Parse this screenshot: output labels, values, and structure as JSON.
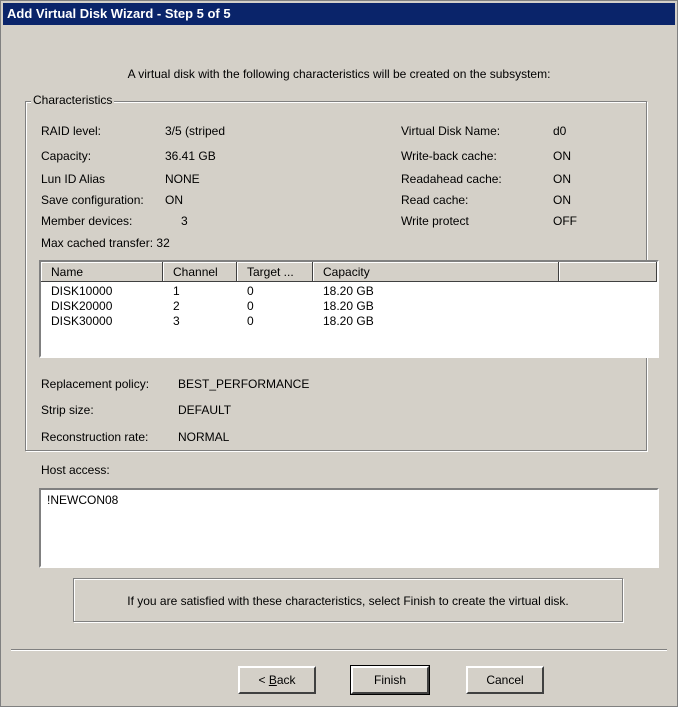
{
  "window": {
    "title": "Add Virtual Disk Wizard - Step 5 of 5"
  },
  "intro": "A virtual disk with the following characteristics will be created on the subsystem:",
  "characteristics": {
    "legend": "Characteristics",
    "left": [
      {
        "label": "RAID level:",
        "value": "3/5 (striped"
      },
      {
        "label": "Capacity:",
        "value": "36.41 GB"
      },
      {
        "label": "Lun ID Alias",
        "value": "NONE"
      },
      {
        "label": "Save configuration:",
        "value": "ON"
      },
      {
        "label": "Member devices:",
        "value": "3"
      }
    ],
    "right": [
      {
        "label": "Virtual Disk Name:",
        "value": "d0"
      },
      {
        "label": "Write-back cache:",
        "value": "ON"
      },
      {
        "label": "Readahead cache:",
        "value": "ON"
      },
      {
        "label": "Read cache:",
        "value": "ON"
      },
      {
        "label": "Write protect",
        "value": "OFF"
      }
    ],
    "max_cached_transfer": {
      "label": "Max cached transfer:",
      "value": "32"
    },
    "devices": {
      "columns": [
        "Name",
        "Channel",
        "Target ...",
        "Capacity"
      ],
      "rows": [
        [
          "DISK10000",
          "1",
          "0",
          "18.20 GB"
        ],
        [
          "DISK20000",
          "2",
          "0",
          "18.20 GB"
        ],
        [
          "DISK30000",
          "3",
          "0",
          "18.20 GB"
        ]
      ]
    },
    "replacement_policy": {
      "label": "Replacement policy:",
      "value": "BEST_PERFORMANCE"
    },
    "strip_size": {
      "label": "Strip size:",
      "value": "DEFAULT"
    },
    "reconstruction_rate": {
      "label": "Reconstruction rate:",
      "value": "NORMAL"
    }
  },
  "host_access": {
    "label": "Host access:",
    "value": "!NEWCON08"
  },
  "info": "If you are satisfied with these characteristics, select Finish to create the virtual disk.",
  "buttons": {
    "back": "< Back",
    "back_prefix": "< ",
    "back_accel": "B",
    "back_rest": "ack",
    "finish": "Finish",
    "cancel": "Cancel"
  }
}
